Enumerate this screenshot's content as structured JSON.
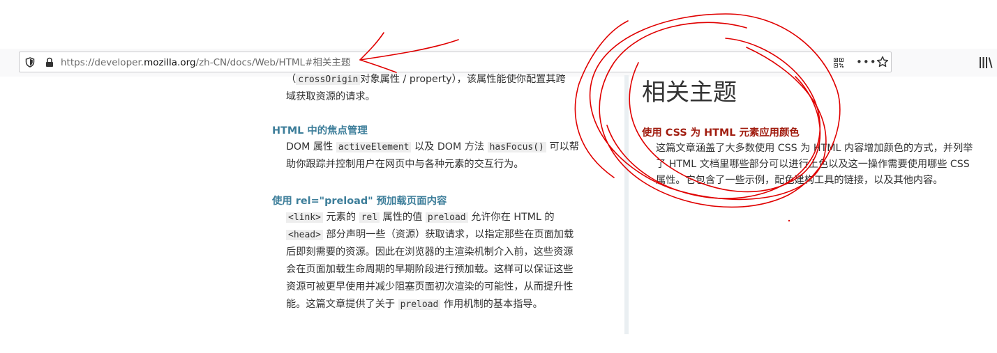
{
  "browser": {
    "url_prefix": "https://developer.",
    "url_host": "mozilla.org",
    "url_path": "/zh-CN/docs/Web/HTML#相关主题"
  },
  "icons": {
    "tracking": "shield-icon",
    "security": "lock-icon",
    "qr": "qr-code-icon",
    "page_actions": "more-icon",
    "bookmark": "star-icon",
    "library": "library-icon"
  },
  "main": {
    "crossorigin_line1_code": "crossOrigin",
    "crossorigin_line1_text": "对象属性 / property），该属性能使你配置其跨",
    "crossorigin_line2": "域获取资源的请求。",
    "focus": {
      "title": "HTML 中的焦点管理",
      "t1": "DOM 属性 ",
      "code1": "activeElement",
      "t2": " 以及 DOM 方法 ",
      "code2": "hasFocus()",
      "t3": " 可以帮",
      "t4": "助你跟踪并控制用户在网页中与各种元素的交互行为。"
    },
    "preload": {
      "title": "使用 rel=\"preload\" 预加载页面内容",
      "code_link": "<link>",
      "t1": " 元素的 ",
      "code_rel": "rel",
      "t2": " 属性的值 ",
      "code_preload": "preload",
      "t3": " 允许你在 HTML 的",
      "code_head": "<head>",
      "t4": " 部分声明一些（资源）获取请求，以指定那些在页面加载",
      "t5": "后即刻需要的资源。因此在浏览器的主渲染机制介入前，这些资源",
      "t6": "会在页面加载生命周期的早期阶段进行预加载。这样可以保证这些",
      "t7": "资源可被更早使用并减少阻塞页面初次渲染的可能性，从而提升性",
      "t8": "能。这篇文章提供了关于 ",
      "code_preload2": "preload",
      "t9": " 作用机制的基本指导。"
    }
  },
  "related": {
    "heading": "相关主题",
    "item_title": "使用 CSS 为 HTML 元素应用颜色",
    "item_desc": "这篇文章涵盖了大多数使用 CSS 为 HTML 内容增加颜色的方式，并列举了 HTML 文档里哪些部分可以进行上色以及这一操作需要使用哪些 CSS 属性。它包含了一些示例，配色建构工具的链接，以及其他内容。"
  },
  "colors": {
    "annotation": "#e00000",
    "link_blue": "#3d7e9a",
    "link_red": "#a11d10"
  }
}
